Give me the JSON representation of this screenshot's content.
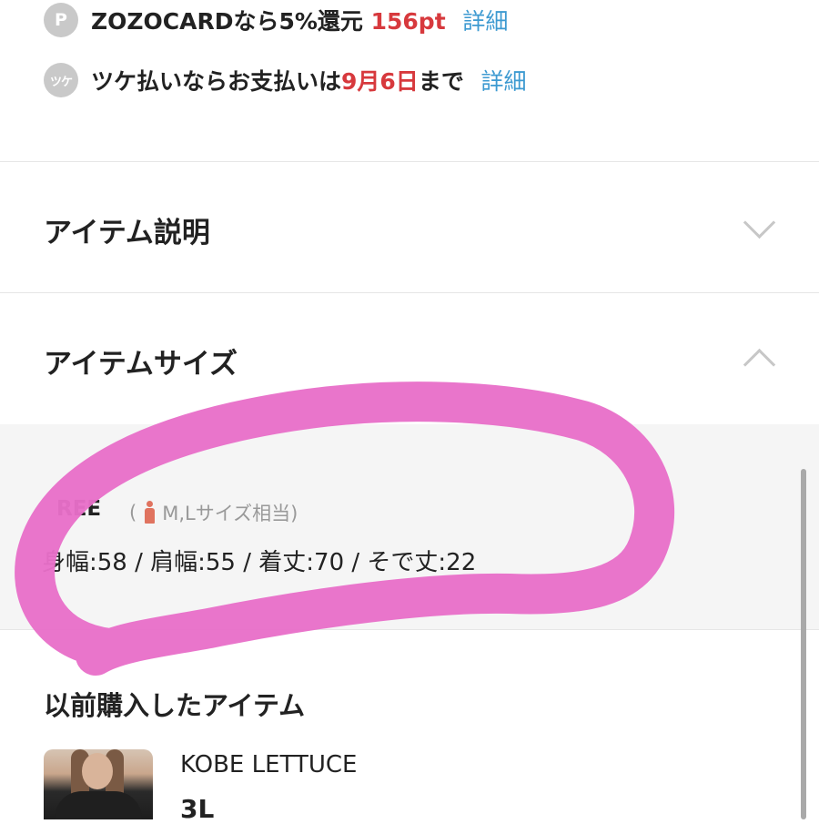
{
  "perks": {
    "points": {
      "icon": "P",
      "text": "ZOZOCARDなら5%還元",
      "value": "156pt",
      "link": "詳細"
    },
    "tsuke": {
      "icon": "ツケ",
      "text_before": "ツケ払いならお支払いは",
      "date": "9月6日",
      "text_after": "まで",
      "link": "詳細"
    }
  },
  "sections": {
    "description": {
      "title": "アイテム説明",
      "state": "collapsed"
    },
    "size": {
      "title": "アイテムサイズ",
      "state": "expanded"
    }
  },
  "size_info": {
    "label": "REE",
    "equiv_open": "(",
    "equiv_text": "M,Lサイズ相当)",
    "measurements": "身幅:58 / 肩幅:55 / 着丈:70 / そで丈:22"
  },
  "previous_purchases": {
    "title": "以前購入したアイテム",
    "items": [
      {
        "brand": "KOBE LETTUCE",
        "size": "3L"
      }
    ]
  },
  "colors": {
    "accent_red": "#d7393d",
    "link_blue": "#3d9ad1",
    "marker_pink": "#e86fc9"
  }
}
